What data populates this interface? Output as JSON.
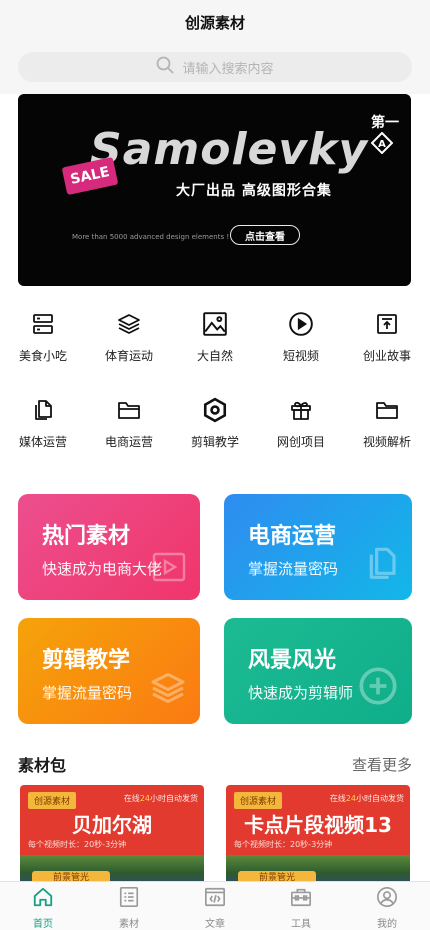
{
  "header": {
    "title": "创源素材"
  },
  "search": {
    "placeholder": "请输入搜索内容"
  },
  "banner": {
    "first_badge": "第一",
    "brand": "Samolevky",
    "sale": "SALE",
    "subtitle": "大厂出品  高级图形合集",
    "tagline": "More than 5000 advanced design elements !",
    "cta": "点击查看"
  },
  "categories": [
    {
      "label": "美食小吃",
      "icon": "layout-icon"
    },
    {
      "label": "体育运动",
      "icon": "layers-icon"
    },
    {
      "label": "大自然",
      "icon": "image-icon"
    },
    {
      "label": "短视频",
      "icon": "play-icon"
    },
    {
      "label": "创业故事",
      "icon": "upload-icon"
    },
    {
      "label": "媒体运营",
      "icon": "file-copy-icon"
    },
    {
      "label": "电商运营",
      "icon": "folder-icon"
    },
    {
      "label": "剪辑教学",
      "icon": "hexagon-icon"
    },
    {
      "label": "网创项目",
      "icon": "gift-icon"
    },
    {
      "label": "视频解析",
      "icon": "folder-open-icon"
    }
  ],
  "cards": [
    {
      "title": "热门素材",
      "subtitle": "快速成为电商大佬",
      "color": "#ee4680"
    },
    {
      "title": "电商运营",
      "subtitle": "掌握流量密码",
      "color": "#1fa0ee"
    },
    {
      "title": "剪辑教学",
      "subtitle": "掌握流量密码",
      "color": "#f89010"
    },
    {
      "title": "风景风光",
      "subtitle": "快速成为剪辑师",
      "color": "#16b58f"
    }
  ],
  "section": {
    "title": "素材包",
    "more": "查看更多"
  },
  "packs": [
    {
      "tag": "创源素材",
      "online_pre": "在线",
      "online_hl": "24",
      "online_post": "小时自动发货",
      "title": "贝加尔湖",
      "duration": "每个视频时长：20秒-3分钟",
      "button": "前景管光"
    },
    {
      "tag": "创源素材",
      "online_pre": "在线",
      "online_hl": "24",
      "online_post": "小时自动发货",
      "title": "卡点片段视频13",
      "duration": "每个视频时长：20秒-3分钟",
      "button": "前景管光"
    }
  ],
  "tabs": [
    {
      "label": "首页",
      "active": true
    },
    {
      "label": "素材"
    },
    {
      "label": "文章"
    },
    {
      "label": "工具"
    },
    {
      "label": "我的"
    }
  ],
  "colors": {
    "accent": "#18a083"
  }
}
